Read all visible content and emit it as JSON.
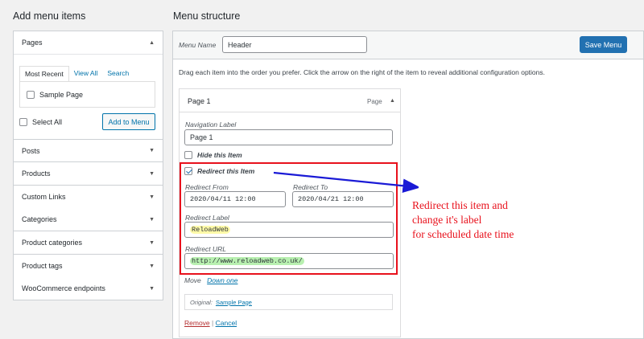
{
  "left": {
    "heading": "Add menu items",
    "pages_panel": {
      "title": "Pages",
      "tabs": [
        {
          "label": "Most Recent",
          "active": true
        },
        {
          "label": "View All",
          "active": false
        },
        {
          "label": "Search",
          "active": false
        }
      ],
      "item_label": "Sample Page",
      "select_all_label": "Select All",
      "add_button_label": "Add to Menu"
    },
    "sections": [
      {
        "label": "Posts"
      },
      {
        "label": "Products"
      },
      {
        "label": "Custom Links"
      },
      {
        "label": "Categories"
      },
      {
        "label": "Product categories"
      },
      {
        "label": "Product tags"
      },
      {
        "label": "WooCommerce endpoints"
      }
    ]
  },
  "right": {
    "heading": "Menu structure",
    "menu_name_label": "Menu Name",
    "menu_name_value": "Header",
    "save_button_label": "Save Menu",
    "instructions": "Drag each item into the order you prefer. Click the arrow on the right of the item to reveal additional configuration options.",
    "item": {
      "title": "Page 1",
      "type": "Page",
      "nav_label_label": "Navigation Label",
      "nav_label_value": "Page 1",
      "hide_label": "Hide this Item",
      "redirect_label": "Redirect this Item",
      "redirect_from_label": "Redirect From",
      "redirect_from_value": "2020/04/11 12:00",
      "redirect_to_label": "Redirect To",
      "redirect_to_value": "2020/04/21 12:00",
      "redirect_label_label": "Redirect Label",
      "redirect_label_value": "ReloadWeb",
      "redirect_url_label": "Redirect URL",
      "redirect_url_value": "http://www.reloadweb.co.uk/",
      "move_label": "Move",
      "move_link": "Down one",
      "original_label": "Original:",
      "original_link": "Sample Page",
      "remove_label": "Remove",
      "separator": "|",
      "cancel_label": "Cancel"
    }
  },
  "annotation": {
    "line1": "Redirect this item and",
    "line2": "change it's label",
    "line3": "for scheduled date time",
    "color": "#e8111c",
    "arrow_color": "#1a1ad6"
  }
}
